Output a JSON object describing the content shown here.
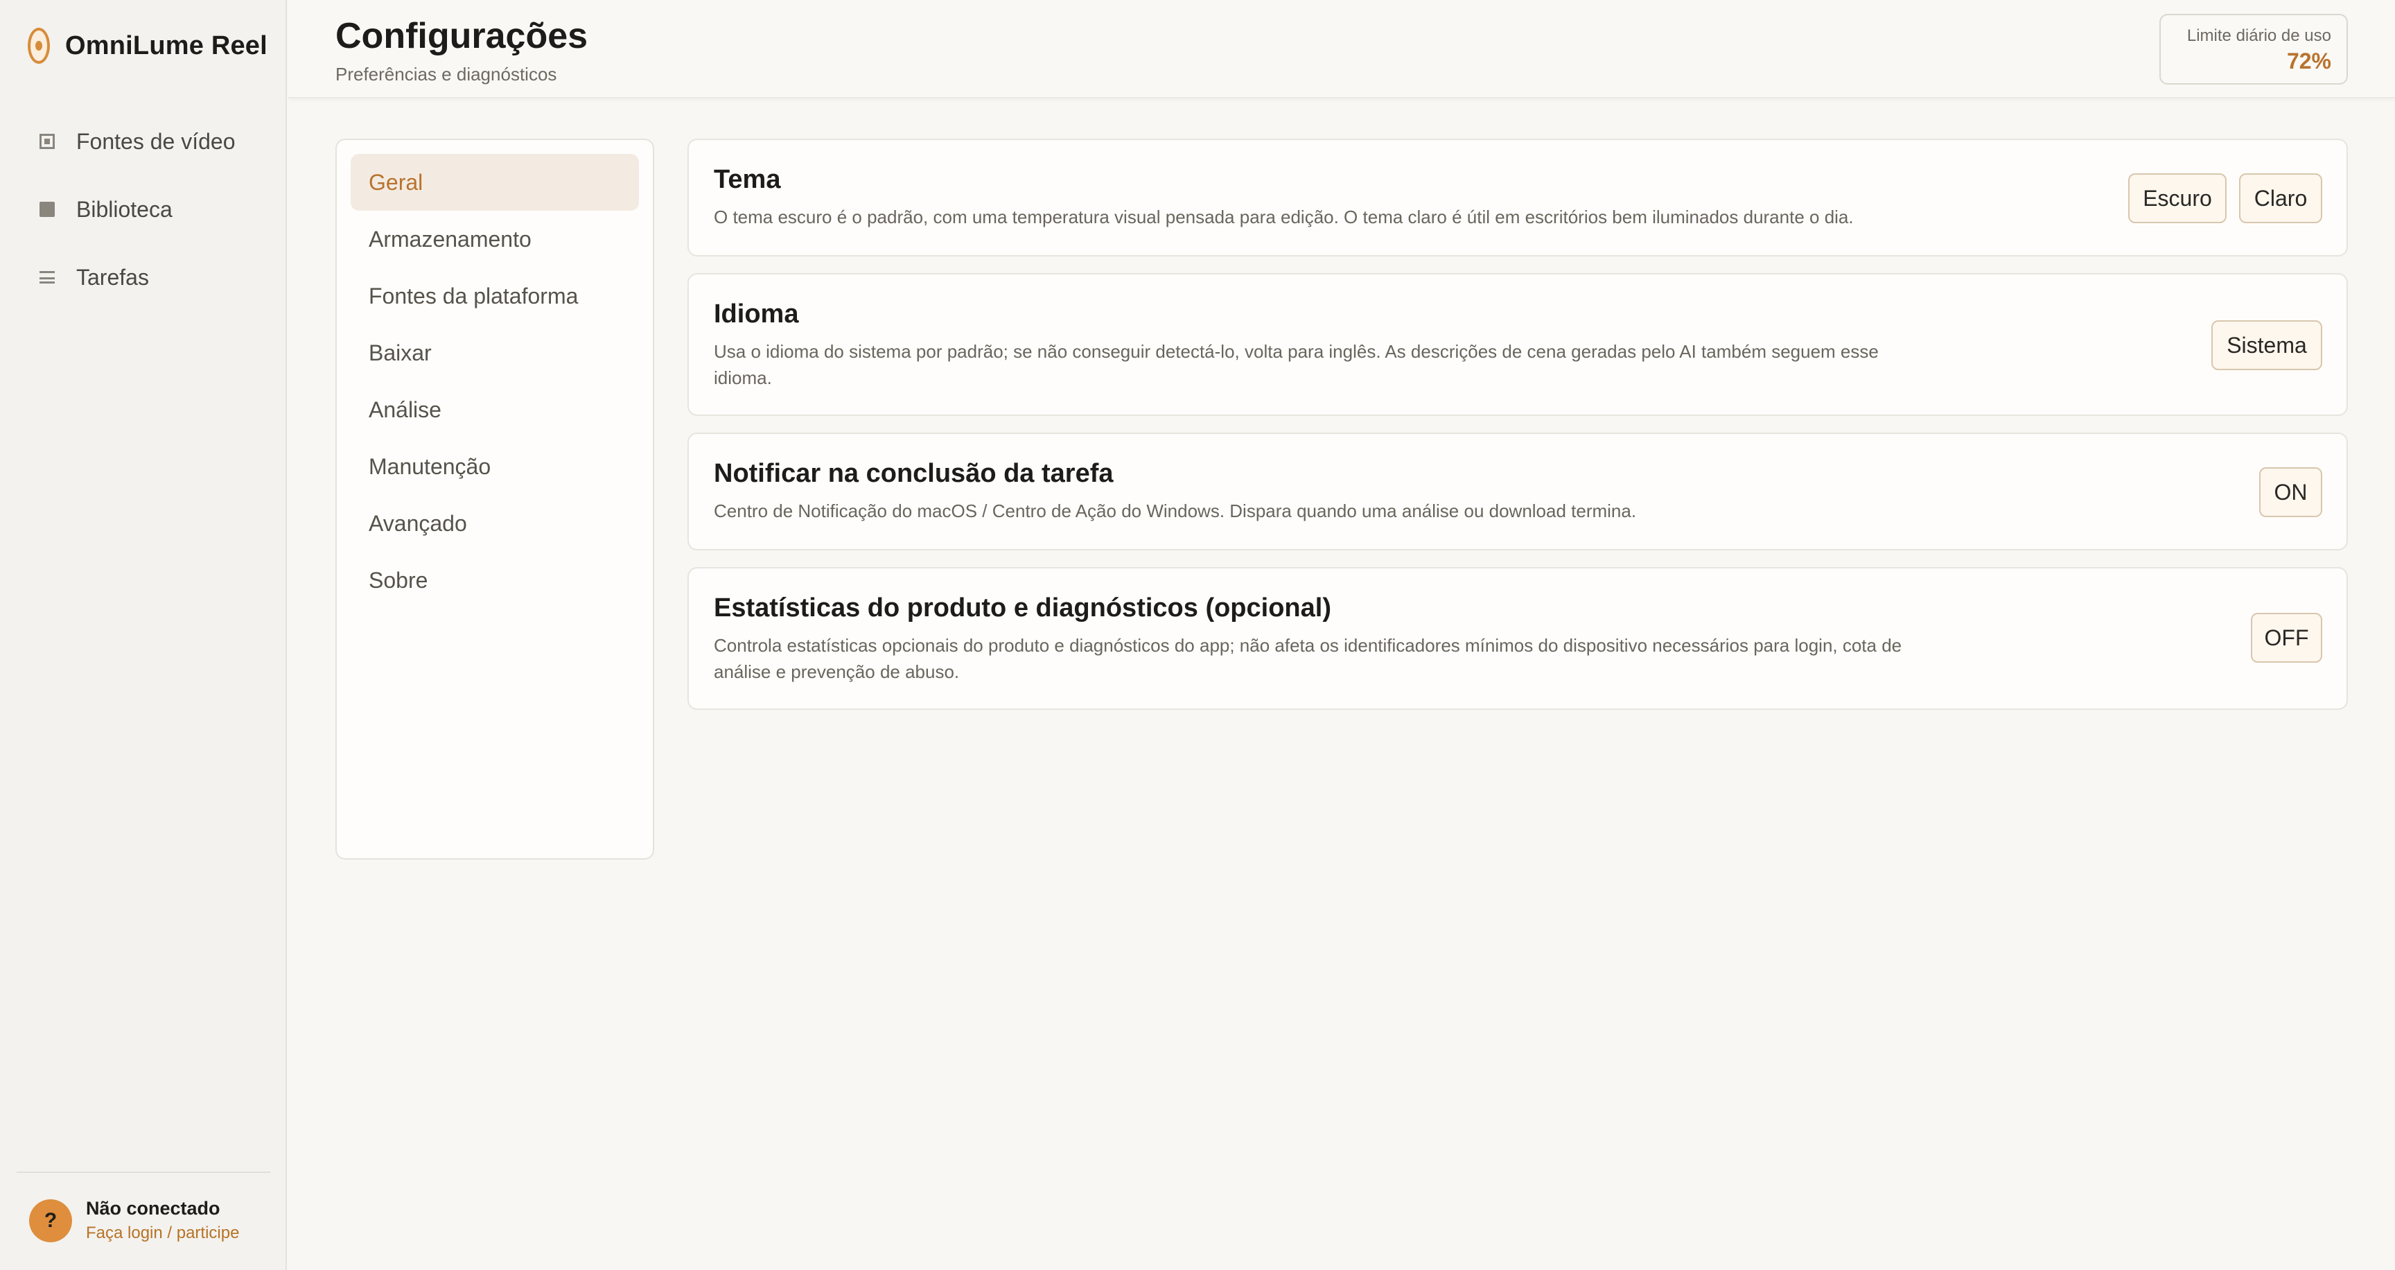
{
  "app": {
    "name": "OmniLume Reel"
  },
  "sidebar": {
    "items": [
      {
        "label": "Fontes de vídeo",
        "icon": "film-icon"
      },
      {
        "label": "Biblioteca",
        "icon": "library-icon"
      },
      {
        "label": "Tarefas",
        "icon": "list-icon"
      }
    ],
    "account": {
      "status": "Não conectado",
      "action": "Faça login / participe",
      "avatar_glyph": "?"
    }
  },
  "header": {
    "title": "Configurações",
    "subtitle": "Preferências e diagnósticos",
    "usage": {
      "label": "Limite diário de uso",
      "value": "72%"
    }
  },
  "settings_menu": {
    "items": [
      "Geral",
      "Armazenamento",
      "Fontes da plataforma",
      "Baixar",
      "Análise",
      "Manutenção",
      "Avançado",
      "Sobre"
    ],
    "active": "Geral"
  },
  "cards": {
    "theme": {
      "title": "Tema",
      "description": "O tema escuro é o padrão, com uma temperatura visual pensada para edição. O tema claro é útil em escritórios bem iluminados durante o dia.",
      "dark_label": "Escuro",
      "light_label": "Claro"
    },
    "language": {
      "title": "Idioma",
      "description": "Usa o idioma do sistema por padrão; se não conseguir detectá-lo, volta para inglês. As descrições de cena geradas pelo AI também seguem esse idioma.",
      "value": "Sistema"
    },
    "notify": {
      "title": "Notificar na conclusão da tarefa",
      "description": "Centro de Notificação do macOS / Centro de Ação do Windows. Dispara quando uma análise ou download termina.",
      "value": "ON"
    },
    "stats": {
      "title": "Estatísticas do produto e diagnósticos (opcional)",
      "description": "Controla estatísticas opcionais do produto e diagnósticos do app; não afeta os identificadores mínimos do dispositivo necessários para login, cota de análise e prevenção de abuso.",
      "value": "OFF"
    }
  },
  "colors": {
    "accent": "#b8732d",
    "brand": "#d78c3b",
    "active_bg": "#f3ebe2"
  }
}
